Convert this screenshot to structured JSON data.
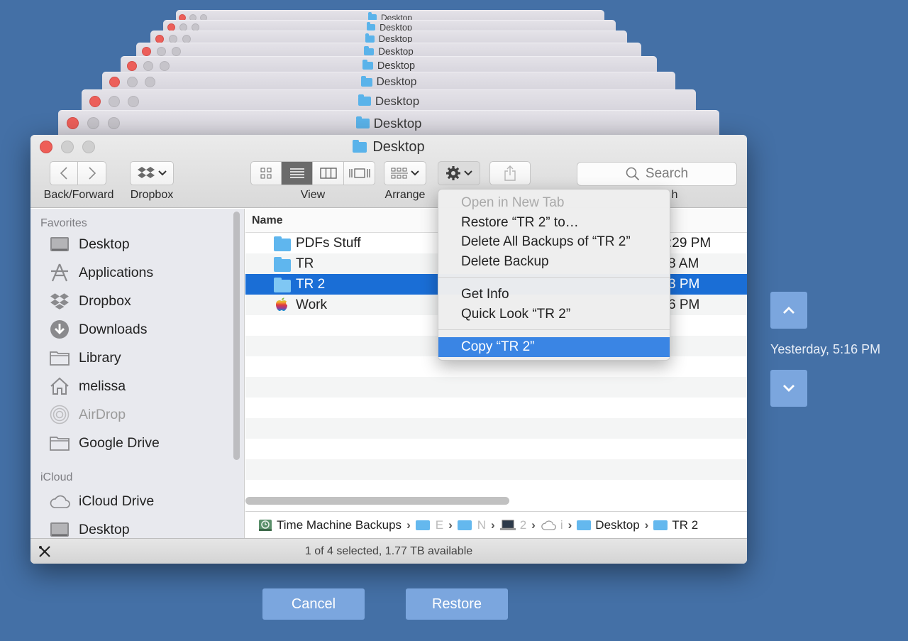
{
  "stack": {
    "title": "Desktop",
    "windows": [
      {
        "title": "Desktop"
      },
      {
        "title": "Desktop"
      },
      {
        "title": "Desktop"
      },
      {
        "title": "Desktop"
      },
      {
        "title": "Desktop"
      },
      {
        "title": "Desktop"
      },
      {
        "title": "Desktop"
      },
      {
        "title": "Desktop"
      }
    ]
  },
  "window": {
    "title": "Desktop"
  },
  "toolbar": {
    "back_forward_label": "Back/Forward",
    "dropbox_label": "Dropbox",
    "view_label": "View",
    "arrange_label": "Arrange",
    "search_placeholder": "Search",
    "search_label_tail": "h"
  },
  "sidebar": {
    "favorites_heading": "Favorites",
    "favorites": [
      {
        "label": "Desktop",
        "icon": "desktop-icon"
      },
      {
        "label": "Applications",
        "icon": "applications-icon"
      },
      {
        "label": "Dropbox",
        "icon": "dropbox-icon"
      },
      {
        "label": "Downloads",
        "icon": "downloads-icon"
      },
      {
        "label": "Library",
        "icon": "folder-icon"
      },
      {
        "label": "melissa",
        "icon": "home-icon"
      },
      {
        "label": "AirDrop",
        "icon": "airdrop-icon"
      },
      {
        "label": "Google Drive",
        "icon": "folder-icon"
      }
    ],
    "icloud_heading": "iCloud",
    "icloud": [
      {
        "label": "iCloud Drive",
        "icon": "cloud-icon"
      },
      {
        "label": "Desktop",
        "icon": "desktop-icon"
      }
    ]
  },
  "list": {
    "name_header": "Name",
    "rows": [
      {
        "name": "PDFs Stuff",
        "date": ":29 PM",
        "icon": "folder-icon"
      },
      {
        "name": "TR",
        "date": "8 AM",
        "icon": "folder-icon"
      },
      {
        "name": "TR 2",
        "date": "3 PM",
        "icon": "folder-icon",
        "selected": true
      },
      {
        "name": "Work",
        "date": "6 PM",
        "icon": "apple-icon"
      }
    ]
  },
  "context_menu": {
    "items_group1": [
      "Open in New Tab",
      "Restore “TR 2” to…",
      "Delete All Backups of “TR 2”",
      "Delete Backup"
    ],
    "items_group2": [
      "Get Info",
      "Quick Look “TR 2”"
    ],
    "items_group3": [
      "Copy “TR 2”"
    ]
  },
  "pathbar": {
    "root": "Time Machine Backups",
    "seg1": "E",
    "seg2": "N",
    "seg3": "2",
    "seg4": "i",
    "desktop": "Desktop",
    "current": "TR 2"
  },
  "status": {
    "text": "1 of 4 selected, 1.77 TB available"
  },
  "timemachine": {
    "date": "Yesterday, 5:16 PM"
  },
  "buttons": {
    "cancel": "Cancel",
    "restore": "Restore"
  }
}
